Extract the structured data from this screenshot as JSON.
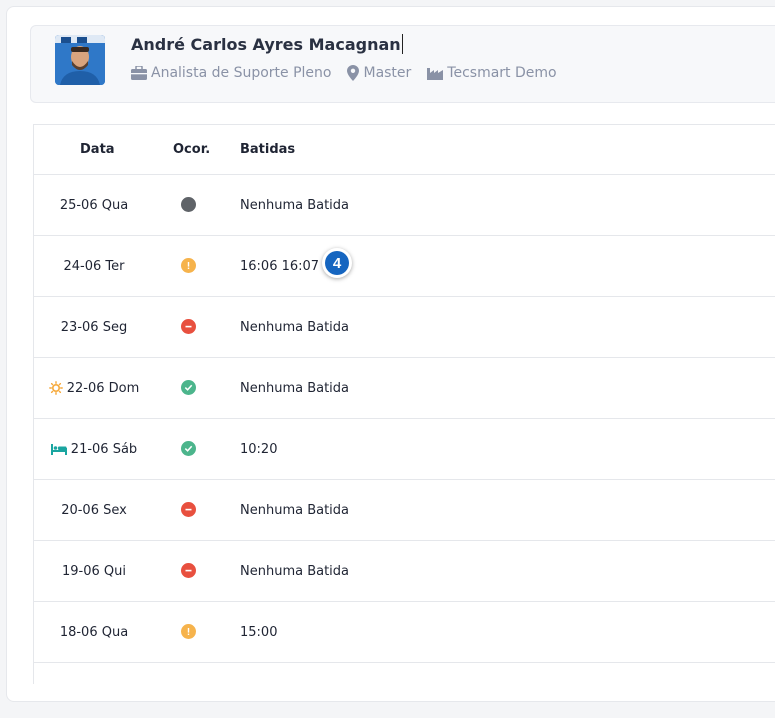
{
  "profile": {
    "name": "André Carlos Ayres Macagnan",
    "role": "Analista de Suporte Pleno",
    "location": "Master",
    "company": "Tecsmart Demo"
  },
  "table": {
    "headers": {
      "date": "Data",
      "occurrence": "Ocor.",
      "punches": "Batidas"
    },
    "rows": [
      {
        "date": "25-06 Qua",
        "status": "none",
        "punches": "Nenhuma Batida"
      },
      {
        "date": "24-06 Ter",
        "status": "warning",
        "punches": "16:06 16:07"
      },
      {
        "date": "23-06 Seg",
        "status": "error",
        "punches": "Nenhuma Batida"
      },
      {
        "date": "22-06 Dom",
        "status": "ok",
        "punches": "Nenhuma Batida",
        "icon": "sun-icon"
      },
      {
        "date": "21-06 Sáb",
        "status": "ok",
        "punches": "10:20",
        "icon": "bed-icon"
      },
      {
        "date": "20-06 Sex",
        "status": "error",
        "punches": "Nenhuma Batida"
      },
      {
        "date": "19-06 Qui",
        "status": "error",
        "punches": "Nenhuma Batida"
      },
      {
        "date": "18-06 Qua",
        "status": "warning",
        "punches": "15:00"
      }
    ]
  },
  "annotation": {
    "label": "4"
  },
  "colors": {
    "none": "#5f6368",
    "warning": "#f6b34c",
    "error": "#e8503f",
    "ok": "#4cb58c",
    "badge": "#1565c0"
  }
}
